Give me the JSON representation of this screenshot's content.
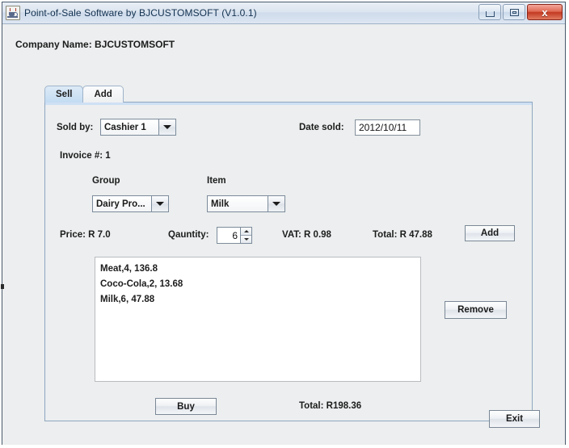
{
  "window": {
    "title": "Point-of-Sale Software by BJCUSTOMSOFT   (V1.0.1)",
    "app_icon": "java-coffee-cup-icon",
    "controls": {
      "minimize": "minimize-icon",
      "maximize": "maximize-icon",
      "close": "x"
    }
  },
  "header": {
    "company_label": "Company Name: BJCUSTOMSOFT"
  },
  "tabs": [
    {
      "label": "Sell",
      "active": true
    },
    {
      "label": "Add",
      "active": false
    }
  ],
  "sell_panel": {
    "sold_by": {
      "label": "Sold by:",
      "value": "Cashier 1"
    },
    "date_sold": {
      "label": "Date sold:",
      "value": "2012/10/11"
    },
    "invoice": {
      "label": "Invoice #: 1"
    },
    "group": {
      "label": "Group",
      "value": "Dairy Pro..."
    },
    "item": {
      "label": "Item",
      "value": "Milk"
    },
    "price": {
      "label": "Price: R 7.0"
    },
    "quantity": {
      "label": "Qauntity:",
      "value": "6"
    },
    "vat": {
      "label": "VAT: R 0.98"
    },
    "line_total": {
      "label": "Total: R 47.88"
    },
    "add_button": "Add",
    "remove_button": "Remove",
    "buy_button": "Buy",
    "grand_total": "Total: R198.36",
    "cart_items": [
      "Meat,4, 136.8",
      "Coco-Cola,2, 13.68",
      "Milk,6, 47.88"
    ]
  },
  "footer": {
    "exit_button": "Exit"
  },
  "colors": {
    "titlebar_text": "#12314f",
    "panel_bg": "#eceeef",
    "tab_active_bg": "#c3dcf2",
    "tab_border": "#9fb4cb",
    "close_button": "#c33a22"
  }
}
